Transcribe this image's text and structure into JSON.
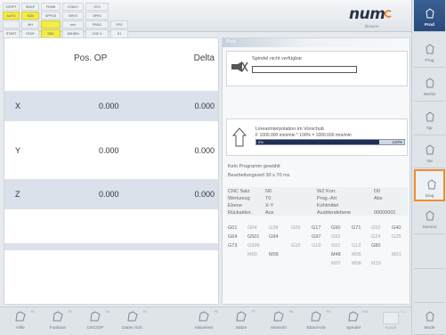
{
  "status_grid": [
    [
      "SCRPT",
      "SNGP",
      "FHSW",
      "CSDG+",
      "STO",
      ""
    ],
    [
      "AUTO",
      "SON",
      "SPPOS",
      "SRVS",
      "SPKS",
      ""
    ],
    [
      "",
      "MH",
      "",
      "min",
      "FRDG",
      "SFG",
      ""
    ],
    [
      "START",
      "FEDF",
      "SDD",
      "JMHIEN",
      "CNC 0",
      "K1"
    ]
  ],
  "brand": {
    "logo": "num",
    "tagline": "flexium+"
  },
  "axis_table": {
    "col_pos": "Pos. OP",
    "col_delta": "Delta",
    "rows": [
      {
        "axis": "X",
        "pos": "0.000",
        "delta": "0.000"
      },
      {
        "axis": "Y",
        "pos": "0.000",
        "delta": "0.000"
      },
      {
        "axis": "Z",
        "pos": "0.000",
        "delta": "0.000"
      }
    ]
  },
  "info": {
    "tab_label": "Prod",
    "spindle_text": "Spindel nicht verfügbar",
    "interp_line1": "Linearinterpolation im Vorschub",
    "interp_line2": "F 1000.000 mm/min * 100% = 1000.000 mm/min",
    "feed_percent": 100,
    "feed_pct_label": "0%",
    "feed_bar_label": "120%",
    "no_program": "Kein Programm gewählt",
    "cycle_time": "Bearbeitungszeit 30 s 70 ms",
    "status_left": [
      [
        "CNC Satz",
        "N0"
      ],
      [
        "Werkzeug",
        "T0"
      ],
      [
        "Ebene",
        "X-Y"
      ],
      [
        "Rückaktivr.",
        "Aus"
      ]
    ],
    "status_right": [
      [
        "WZ Korr.",
        "D0"
      ],
      [
        "Prog.-Art",
        "Abs"
      ],
      [
        "Kühlmittel",
        ""
      ],
      [
        "Ausblendebene",
        "00000001"
      ]
    ],
    "gcode_rows": [
      [
        [
          "G01",
          false
        ],
        [
          "G04",
          true
        ],
        [
          "G38",
          true
        ],
        [
          "G09",
          true
        ],
        [
          "G17",
          false
        ],
        [
          "G90",
          false
        ],
        [
          "G71",
          false
        ],
        [
          "G52",
          true
        ],
        [
          "G40",
          false
        ]
      ],
      [
        [
          "G64",
          false
        ],
        [
          "G501",
          false
        ],
        [
          "G94",
          false
        ],
        [
          "",
          true
        ],
        [
          "G97",
          false
        ],
        [
          "G92",
          true
        ],
        [
          "",
          true
        ],
        [
          "G24",
          true
        ],
        [
          "G25",
          true
        ]
      ],
      [
        [
          "G73",
          false
        ],
        [
          "G999",
          true
        ],
        [
          "",
          true
        ],
        [
          "G10",
          true
        ],
        [
          "G16",
          true
        ],
        [
          "G51",
          true
        ],
        [
          "G12",
          true
        ],
        [
          "G80",
          false
        ],
        [
          "",
          true
        ]
      ],
      [
        [
          "",
          true
        ],
        [
          "M00",
          true
        ],
        [
          "M09",
          false
        ],
        [
          "",
          true
        ],
        [
          "",
          true
        ],
        [
          "M48",
          false
        ],
        [
          "M05",
          true
        ],
        [
          "",
          true
        ],
        [
          "M51",
          true
        ]
      ],
      [
        [
          "",
          true
        ],
        [
          "",
          true
        ],
        [
          "",
          true
        ],
        [
          "",
          true
        ],
        [
          "",
          true
        ],
        [
          "M07",
          true
        ],
        [
          "M08",
          true
        ],
        [
          "M19",
          true
        ],
        [
          "",
          true
        ]
      ]
    ]
  },
  "vkeys": [
    {
      "label": "Prod",
      "active": true
    },
    {
      "label": "Prog"
    },
    {
      "label": "Werkz"
    },
    {
      "label": "Np"
    },
    {
      "label": "Var"
    },
    {
      "label": "Diag",
      "selected": true
    },
    {
      "label": "Service"
    },
    {
      "label": ""
    },
    {
      "label": ""
    },
    {
      "label": "Mode"
    }
  ],
  "hkeys": [
    {
      "label": "Hilfe",
      "fn": "F1"
    },
    {
      "label": "Funktion",
      "fn": "F2"
    },
    {
      "label": "CNC/OP",
      "fn": "F3"
    },
    {
      "label": "Daten Sch.",
      "fn": "F4"
    },
    {
      "label": "",
      "fn": ""
    },
    {
      "label": "Aktivieren",
      "fn": "F6"
    },
    {
      "label": "Sätze",
      "fn": "F7"
    },
    {
      "label": "Aktivinfo",
      "fn": "F8"
    },
    {
      "label": "Eban/Arla",
      "fn": "F9"
    },
    {
      "label": "Spindel",
      "fn": "F10"
    },
    {
      "label": "Kanal",
      "fn": "F11",
      "off": true
    }
  ]
}
